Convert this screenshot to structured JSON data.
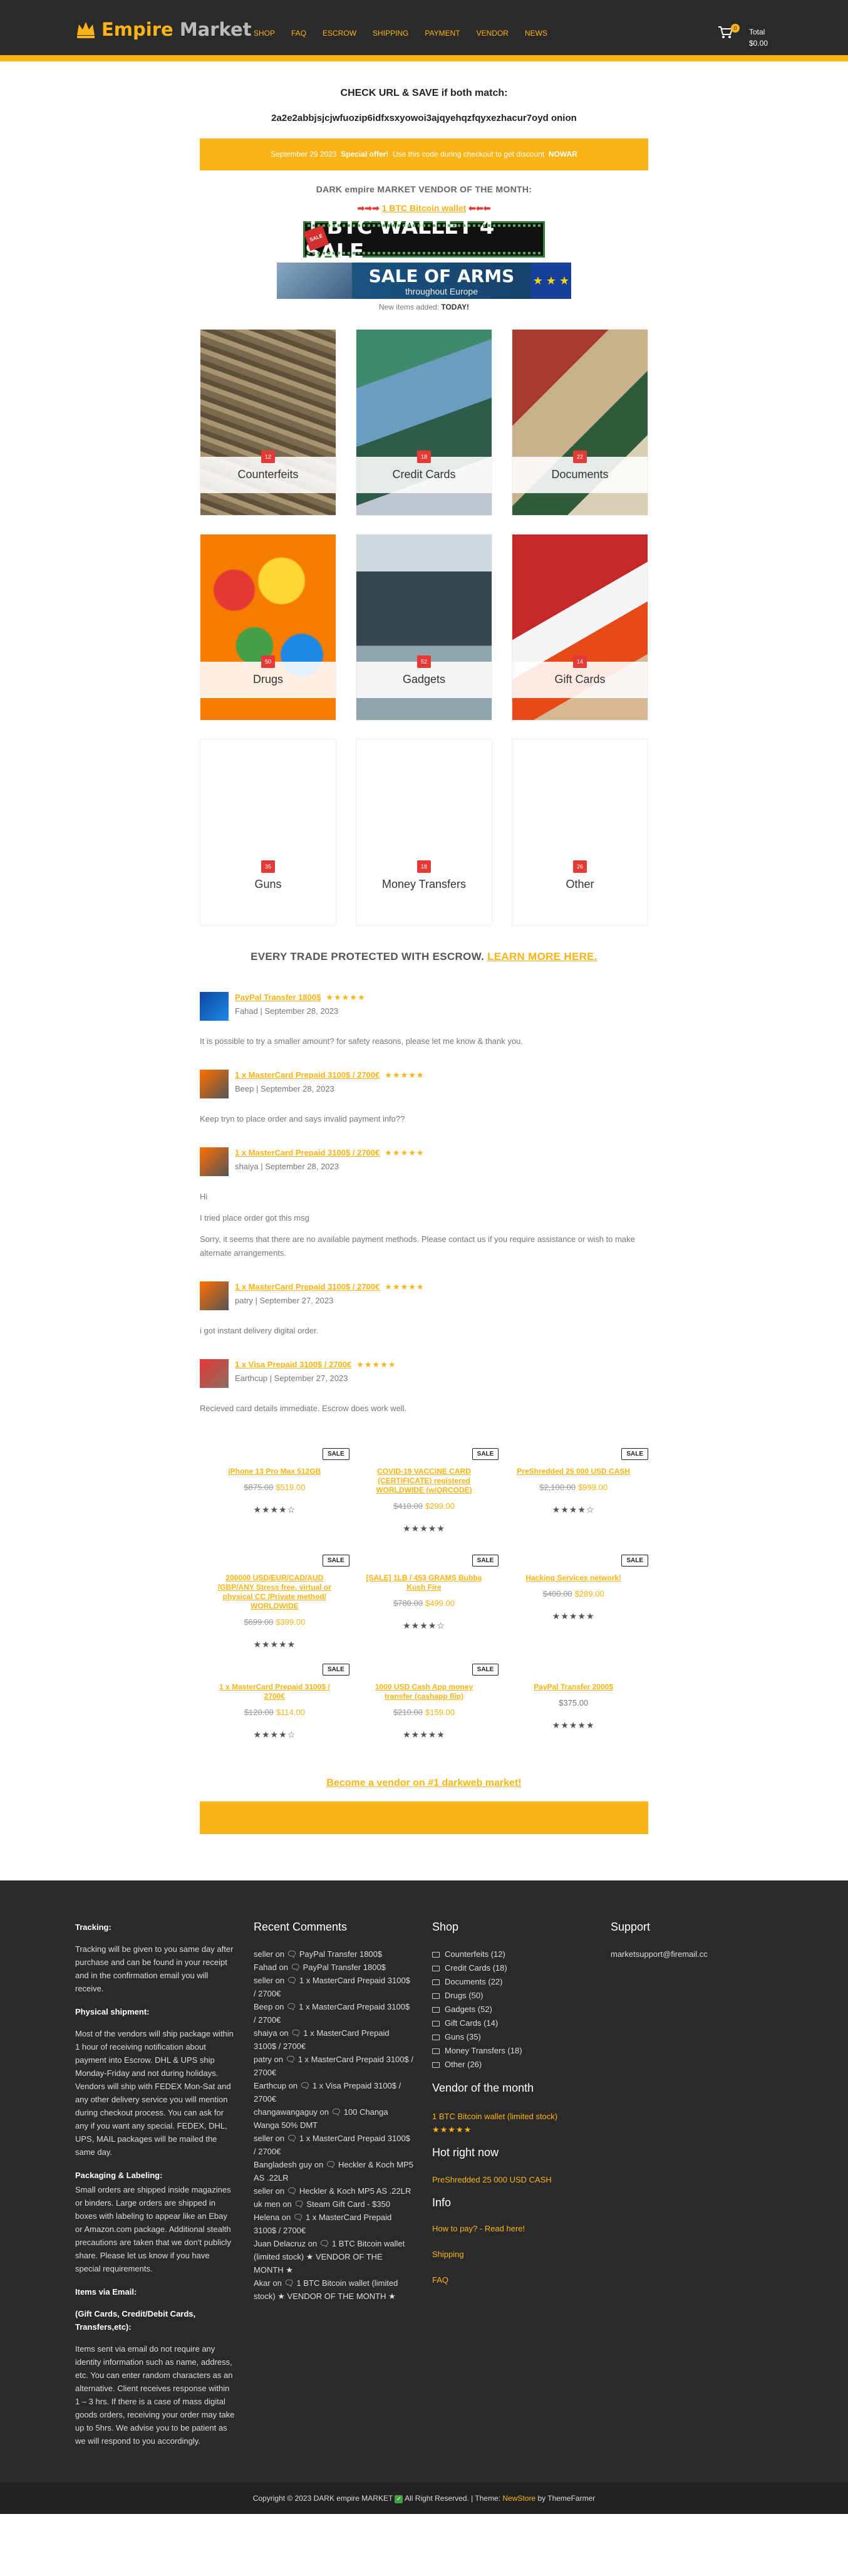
{
  "header": {
    "brand_a": "Empire",
    "brand_b": "Market",
    "nav": [
      "SHOP",
      "FAQ",
      "ESCROW",
      "SHIPPING",
      "PAYMENT",
      "VENDOR",
      "NEWS"
    ],
    "cart_count": "0",
    "total_label": "Total",
    "total_value": "$0.00"
  },
  "intro": {
    "check_line": "CHECK URL & SAVE if both match:",
    "onion": "2a2e2abbjsjcjwfuozip6idfxsxyowoi3ajqyehqzfqyxezhacur7oyd onion",
    "offer_date": "September 29 2023",
    "offer_bold": "Special offer!",
    "offer_text": "Use this code during checkout to get discount",
    "offer_code": "NOWAR",
    "vendor_heading": "DARK empire MARKET VENDOR OF THE MONTH:",
    "vendor_arrows_left": "➡➡➡",
    "vendor_link": "1 BTC Bitcoin wallet",
    "vendor_arrows_right": "⬅⬅⬅",
    "banner1_text": "1 BTC WALLET 4 SALE",
    "banner2_title": "SALE OF ARMS",
    "banner2_sub": "throughout Europe",
    "banner2_stars": "★ ★ ★",
    "new_items_prefix": "New items added:",
    "new_items_value": "TODAY!"
  },
  "categories": [
    {
      "name": "Counterfeits",
      "count": "12"
    },
    {
      "name": "Credit Cards",
      "count": "18"
    },
    {
      "name": "Documents",
      "count": "22"
    },
    {
      "name": "Drugs",
      "count": "50"
    },
    {
      "name": "Gadgets",
      "count": "52"
    },
    {
      "name": "Gift Cards",
      "count": "14"
    },
    {
      "name": "Guns",
      "count": "35"
    },
    {
      "name": "Money Transfers",
      "count": "18"
    },
    {
      "name": "Other",
      "count": "26"
    }
  ],
  "escrow": {
    "text": "EVERY TRADE PROTECTED WITH ESCROW.",
    "link": "LEARN MORE HERE."
  },
  "reviews": [
    {
      "title": "PayPal Transfer 1800$",
      "stars": "★★★★★",
      "author": "Fahad",
      "date": "September 28, 2023",
      "texts": [
        "It is possible to try a smaller amount? for safety reasons, please let me know & thank you."
      ]
    },
    {
      "title": "1 x MasterCard Prepaid 3100$ / 2700€",
      "stars": "★★★★★",
      "author": "Beep",
      "date": "September 28, 2023",
      "texts": [
        "Keep tryn to place order and says invalid payment info??"
      ]
    },
    {
      "title": "1 x MasterCard Prepaid 3100$ / 2700€",
      "stars": "★★★★★",
      "author": "shaiya",
      "date": "September 28, 2023",
      "texts": [
        "Hi",
        "I tried place order got this msg",
        "Sorry, it seems that there are no available payment methods. Please contact us if you require assistance or wish to make alternate arrangements."
      ]
    },
    {
      "title": "1 x MasterCard Prepaid 3100$ / 2700€",
      "stars": "★★★★★",
      "author": "patry",
      "date": "September 27, 2023",
      "texts": [
        "i got instant delivery digital order."
      ]
    },
    {
      "title": "1 x Visa Prepaid 3100$ / 2700€",
      "stars": "★★★★★",
      "author": "Earthcup",
      "date": "September 27, 2023",
      "texts": [
        "Recieved card details immediate. Escrow does work well."
      ]
    }
  ],
  "products": [
    {
      "title": "iPhone 13 Pro Max 512GB",
      "old": "$875.00",
      "new": "$519.00",
      "sale": "SALE",
      "stars": "★★★★☆"
    },
    {
      "title": "COVID-19 VACCINE CARD (CERTIFICATE) registered WORLDWIDE (w/QRCODE)",
      "old": "$410.00",
      "new": "$299.00",
      "sale": "SALE",
      "stars": "★★★★★"
    },
    {
      "title": "PreShredded 25 000 USD CASH",
      "old": "$2,100.00",
      "new": "$999.00",
      "sale": "SALE",
      "stars": "★★★★☆"
    },
    {
      "title": "200000 USD/EUR/CAD/AUD /GBP/ANY Stress free, virtual or physical CC /Private method/ WORLDWIDE",
      "old": "$699.00",
      "new": "$399.00",
      "sale": "SALE",
      "stars": "★★★★★"
    },
    {
      "title": "[SALE] 1LB / 453 GRAMS Bubba Kush Fire",
      "old": "$780.00",
      "new": "$499.00",
      "sale": "SALE",
      "stars": "★★★★☆"
    },
    {
      "title": "Hacking Services network!",
      "old": "$400.00",
      "new": "$289.00",
      "sale": "SALE",
      "stars": "★★★★★"
    },
    {
      "title": "1 x MasterCard Prepaid 3100$ / 2700€",
      "old": "$120.00",
      "new": "$114.00",
      "sale": "SALE",
      "stars": "★★★★☆"
    },
    {
      "title": "1000 USD Cash App money transfer (cashapp flip)",
      "old": "$210.00",
      "new": "$159.00",
      "sale": "SALE",
      "stars": "★★★★★"
    },
    {
      "title": "PayPal Transfer 2000$",
      "old": "",
      "new": "$375.00",
      "sale": "",
      "stars": "★★★★★"
    }
  ],
  "become": "Become a vendor on #1 darkweb market!",
  "footer": {
    "tracking_h": "Tracking:",
    "tracking_p": "Tracking will be given to you same day after purchase and can be found in your receipt and in the confirmation email you will receive.",
    "shipment_h": "Physical shipment:",
    "shipment_p": "Most of the vendors will ship package within 1 hour of receiving notification about payment into Escrow. DHL & UPS ship Monday-Friday and not during holidays. Vendors will ship with FEDEX Mon-Sat and any other delivery service you will mention during checkout process. You can ask for any if you want any special. FEDEX, DHL, UPS, MAIL packages will be mailed the same day.",
    "packaging_h": "Packaging & Labeling:",
    "packaging_p": "Small orders are shipped inside magazines or binders. Large orders are shipped in boxes with labeling to appear like an Ebay or Amazon.com package. Additional stealth precautions are taken that we don't publicly share. Please let us know if you have special requirements.",
    "email_h": "Items via Email:",
    "email_sub": "(Gift Cards, Credit/Debit Cards, Transfers,etc):",
    "email_p": "Items sent via email do not require any identity information such as name, address, etc. You can enter random characters as an alternative. Client receives response within 1 – 3 hrs. If there is a case of mass digital goods orders, receiving your order may take up to 5hrs. We advise you to be patient as we will respond to you accordingly.",
    "recent_h": "Recent Comments",
    "comments": [
      "seller on 🗨 PayPal Transfer 1800$",
      "Fahad on 🗨 PayPal Transfer 1800$",
      "seller on 🗨 1 x MasterCard Prepaid 3100$ / 2700€",
      "Beep on 🗨 1 x MasterCard Prepaid 3100$ / 2700€",
      "shaiya on 🗨 1 x MasterCard Prepaid 3100$ / 2700€",
      "patry on 🗨 1 x MasterCard Prepaid 3100$ / 2700€",
      "Earthcup on 🗨 1 x Visa Prepaid 3100$ / 2700€",
      "changawangaguy on 🗨 100 Changa Wanga 50% DMT",
      "seller on 🗨 1 x MasterCard Prepaid 3100$ / 2700€",
      "Bangladesh guy on 🗨 Heckler & Koch MP5 AS .22LR",
      "seller on 🗨 Heckler & Koch MP5 AS .22LR",
      "uk men on 🗨 Steam Gift Card - $350",
      "Helena on 🗨 1 x MasterCard Prepaid 3100$ / 2700€",
      "Juan Delacruz on 🗨 1 BTC Bitcoin wallet (limited stock) ★ VENDOR OF THE MONTH ★",
      "Akar on 🗨 1 BTC Bitcoin wallet (limited stock) ★ VENDOR OF THE MONTH ★"
    ],
    "shop_h": "Shop",
    "shop_items": [
      "Counterfeits (12)",
      "Credit Cards (18)",
      "Documents (22)",
      "Drugs (50)",
      "Gadgets (52)",
      "Gift Cards (14)",
      "Guns (35)",
      "Money Transfers (18)",
      "Other (26)"
    ],
    "vendor_h": "Vendor of the month",
    "vendor_link": "1 BTC Bitcoin wallet (limited stock)",
    "vendor_stars": "★★★★★",
    "hot_h": "Hot right now",
    "hot_link": "PreShredded 25 000 USD CASH",
    "info_h": "Info",
    "info_links": [
      "How to pay? - Read here!",
      "Shipping",
      "FAQ"
    ],
    "support_h": "Support",
    "support_email": "marketsupport@firemail.cc",
    "copyright_a": "Copyright © 2023 DARK empire MARKET",
    "copyright_b": "All Right Reserved.  |  Theme:",
    "theme_name": "NewStore",
    "theme_by": "by ThemeFarmer"
  }
}
